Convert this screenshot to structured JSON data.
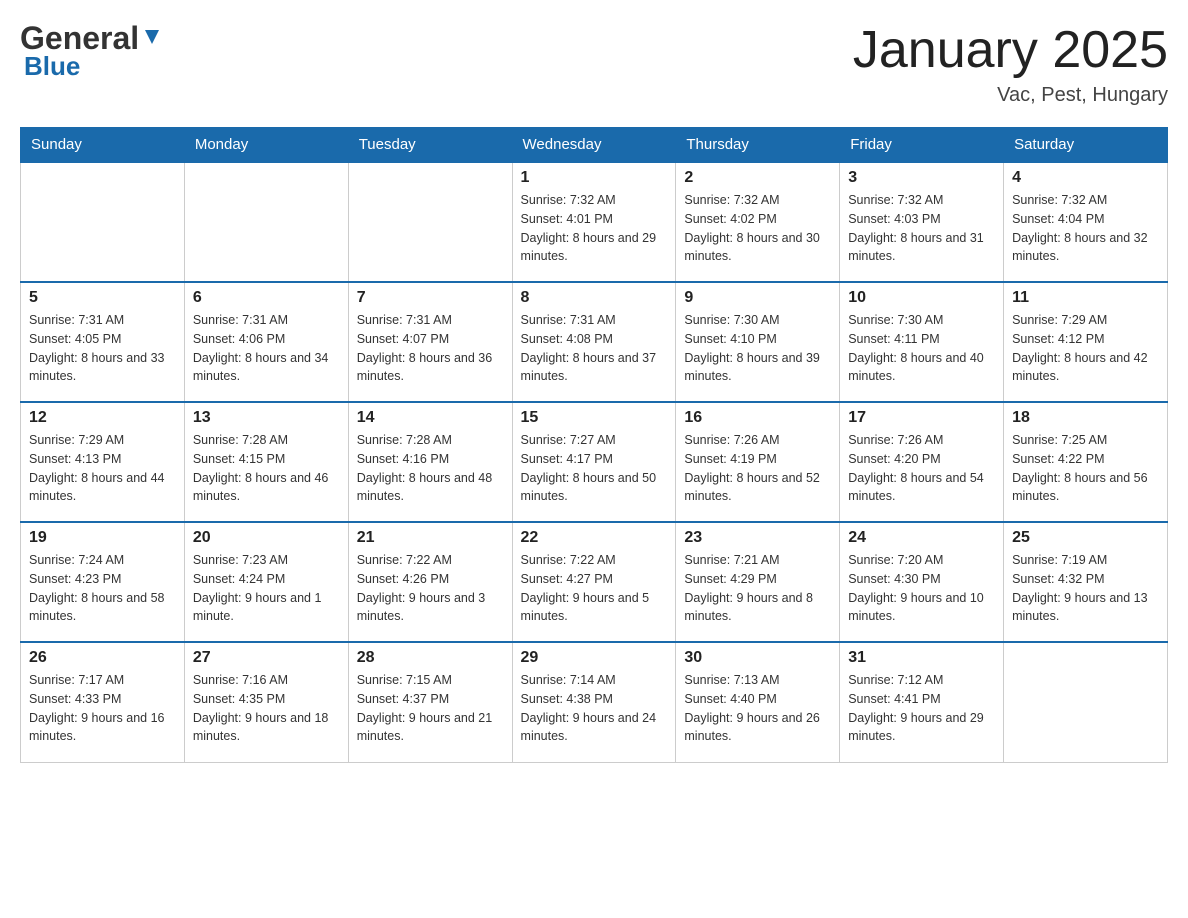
{
  "header": {
    "logo_main": "General",
    "logo_sub": "Blue",
    "month_title": "January 2025",
    "location": "Vac, Pest, Hungary"
  },
  "days_of_week": [
    "Sunday",
    "Monday",
    "Tuesday",
    "Wednesday",
    "Thursday",
    "Friday",
    "Saturday"
  ],
  "weeks": [
    [
      {
        "day": "",
        "sunrise": "",
        "sunset": "",
        "daylight": ""
      },
      {
        "day": "",
        "sunrise": "",
        "sunset": "",
        "daylight": ""
      },
      {
        "day": "",
        "sunrise": "",
        "sunset": "",
        "daylight": ""
      },
      {
        "day": "1",
        "sunrise": "Sunrise: 7:32 AM",
        "sunset": "Sunset: 4:01 PM",
        "daylight": "Daylight: 8 hours and 29 minutes."
      },
      {
        "day": "2",
        "sunrise": "Sunrise: 7:32 AM",
        "sunset": "Sunset: 4:02 PM",
        "daylight": "Daylight: 8 hours and 30 minutes."
      },
      {
        "day": "3",
        "sunrise": "Sunrise: 7:32 AM",
        "sunset": "Sunset: 4:03 PM",
        "daylight": "Daylight: 8 hours and 31 minutes."
      },
      {
        "day": "4",
        "sunrise": "Sunrise: 7:32 AM",
        "sunset": "Sunset: 4:04 PM",
        "daylight": "Daylight: 8 hours and 32 minutes."
      }
    ],
    [
      {
        "day": "5",
        "sunrise": "Sunrise: 7:31 AM",
        "sunset": "Sunset: 4:05 PM",
        "daylight": "Daylight: 8 hours and 33 minutes."
      },
      {
        "day": "6",
        "sunrise": "Sunrise: 7:31 AM",
        "sunset": "Sunset: 4:06 PM",
        "daylight": "Daylight: 8 hours and 34 minutes."
      },
      {
        "day": "7",
        "sunrise": "Sunrise: 7:31 AM",
        "sunset": "Sunset: 4:07 PM",
        "daylight": "Daylight: 8 hours and 36 minutes."
      },
      {
        "day": "8",
        "sunrise": "Sunrise: 7:31 AM",
        "sunset": "Sunset: 4:08 PM",
        "daylight": "Daylight: 8 hours and 37 minutes."
      },
      {
        "day": "9",
        "sunrise": "Sunrise: 7:30 AM",
        "sunset": "Sunset: 4:10 PM",
        "daylight": "Daylight: 8 hours and 39 minutes."
      },
      {
        "day": "10",
        "sunrise": "Sunrise: 7:30 AM",
        "sunset": "Sunset: 4:11 PM",
        "daylight": "Daylight: 8 hours and 40 minutes."
      },
      {
        "day": "11",
        "sunrise": "Sunrise: 7:29 AM",
        "sunset": "Sunset: 4:12 PM",
        "daylight": "Daylight: 8 hours and 42 minutes."
      }
    ],
    [
      {
        "day": "12",
        "sunrise": "Sunrise: 7:29 AM",
        "sunset": "Sunset: 4:13 PM",
        "daylight": "Daylight: 8 hours and 44 minutes."
      },
      {
        "day": "13",
        "sunrise": "Sunrise: 7:28 AM",
        "sunset": "Sunset: 4:15 PM",
        "daylight": "Daylight: 8 hours and 46 minutes."
      },
      {
        "day": "14",
        "sunrise": "Sunrise: 7:28 AM",
        "sunset": "Sunset: 4:16 PM",
        "daylight": "Daylight: 8 hours and 48 minutes."
      },
      {
        "day": "15",
        "sunrise": "Sunrise: 7:27 AM",
        "sunset": "Sunset: 4:17 PM",
        "daylight": "Daylight: 8 hours and 50 minutes."
      },
      {
        "day": "16",
        "sunrise": "Sunrise: 7:26 AM",
        "sunset": "Sunset: 4:19 PM",
        "daylight": "Daylight: 8 hours and 52 minutes."
      },
      {
        "day": "17",
        "sunrise": "Sunrise: 7:26 AM",
        "sunset": "Sunset: 4:20 PM",
        "daylight": "Daylight: 8 hours and 54 minutes."
      },
      {
        "day": "18",
        "sunrise": "Sunrise: 7:25 AM",
        "sunset": "Sunset: 4:22 PM",
        "daylight": "Daylight: 8 hours and 56 minutes."
      }
    ],
    [
      {
        "day": "19",
        "sunrise": "Sunrise: 7:24 AM",
        "sunset": "Sunset: 4:23 PM",
        "daylight": "Daylight: 8 hours and 58 minutes."
      },
      {
        "day": "20",
        "sunrise": "Sunrise: 7:23 AM",
        "sunset": "Sunset: 4:24 PM",
        "daylight": "Daylight: 9 hours and 1 minute."
      },
      {
        "day": "21",
        "sunrise": "Sunrise: 7:22 AM",
        "sunset": "Sunset: 4:26 PM",
        "daylight": "Daylight: 9 hours and 3 minutes."
      },
      {
        "day": "22",
        "sunrise": "Sunrise: 7:22 AM",
        "sunset": "Sunset: 4:27 PM",
        "daylight": "Daylight: 9 hours and 5 minutes."
      },
      {
        "day": "23",
        "sunrise": "Sunrise: 7:21 AM",
        "sunset": "Sunset: 4:29 PM",
        "daylight": "Daylight: 9 hours and 8 minutes."
      },
      {
        "day": "24",
        "sunrise": "Sunrise: 7:20 AM",
        "sunset": "Sunset: 4:30 PM",
        "daylight": "Daylight: 9 hours and 10 minutes."
      },
      {
        "day": "25",
        "sunrise": "Sunrise: 7:19 AM",
        "sunset": "Sunset: 4:32 PM",
        "daylight": "Daylight: 9 hours and 13 minutes."
      }
    ],
    [
      {
        "day": "26",
        "sunrise": "Sunrise: 7:17 AM",
        "sunset": "Sunset: 4:33 PM",
        "daylight": "Daylight: 9 hours and 16 minutes."
      },
      {
        "day": "27",
        "sunrise": "Sunrise: 7:16 AM",
        "sunset": "Sunset: 4:35 PM",
        "daylight": "Daylight: 9 hours and 18 minutes."
      },
      {
        "day": "28",
        "sunrise": "Sunrise: 7:15 AM",
        "sunset": "Sunset: 4:37 PM",
        "daylight": "Daylight: 9 hours and 21 minutes."
      },
      {
        "day": "29",
        "sunrise": "Sunrise: 7:14 AM",
        "sunset": "Sunset: 4:38 PM",
        "daylight": "Daylight: 9 hours and 24 minutes."
      },
      {
        "day": "30",
        "sunrise": "Sunrise: 7:13 AM",
        "sunset": "Sunset: 4:40 PM",
        "daylight": "Daylight: 9 hours and 26 minutes."
      },
      {
        "day": "31",
        "sunrise": "Sunrise: 7:12 AM",
        "sunset": "Sunset: 4:41 PM",
        "daylight": "Daylight: 9 hours and 29 minutes."
      },
      {
        "day": "",
        "sunrise": "",
        "sunset": "",
        "daylight": ""
      }
    ]
  ]
}
